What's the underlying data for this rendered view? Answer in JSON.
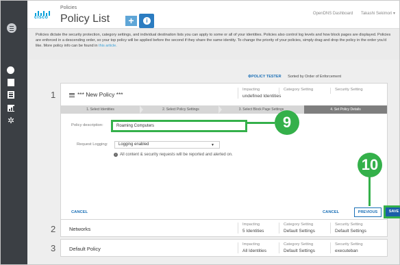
{
  "header": {
    "breadcrumb": "Policies",
    "title": "Policy List",
    "add_label": "+",
    "info_label": "i",
    "app_name": "OpenDNS Dashboard",
    "user": "Takashi Sekimori ▾",
    "logo_text": "cisco"
  },
  "banner": {
    "text": "Policies dictate the security protection, category settings, and individual destination lists you can apply to some or all of your identities.  Policies also control log levels and how block pages are displayed. Policies are enforced in a descending order, so your top policy will be applied before the second if they share the same identity. To change the priority of your policies, simply drag and drop the policy in the order you'd like.  More policy info can be found in",
    "link": "this article."
  },
  "toolbar": {
    "tester": "POLICY TESTER",
    "sort": "Sorted by Order of Enforcement"
  },
  "editing_policy": {
    "number": "1",
    "name": "*** New Policy ***",
    "impacting_label": "Impacting",
    "impacting_value": "undefined Identities",
    "category_label": "Category Setting",
    "category_value": "",
    "security_label": "Security Setting",
    "security_value": "",
    "steps": [
      "1. Select Identities",
      "2. Select Policy Settings",
      "3. Select Block Page Settings",
      "4. Set Policy Details"
    ],
    "description_label": "Policy description:",
    "description_value": "Roaming Computers",
    "logging_label": "Request Logging:",
    "logging_value": "Logging enabled",
    "logging_caret": "▼",
    "note": "All content & security requests will be reported and alerted on.",
    "note_icon": "i",
    "cancel_left": "CANCEL",
    "cancel_right": "CANCEL",
    "previous": "PREVIOUS",
    "save": "SAVE"
  },
  "callouts": {
    "c9": "9",
    "c10": "10"
  },
  "policies": [
    {
      "number": "2",
      "name": "Networks",
      "impacting_label": "Impacting",
      "impacting": "5 Identities",
      "category_label": "Category Setting",
      "category": "Default Settings",
      "security_label": "Security Setting",
      "security": "Default Settings"
    },
    {
      "number": "3",
      "name": "Default Policy",
      "impacting_label": "Impacting",
      "impacting": "All Identities",
      "category_label": "Category Setting",
      "category": "Default Settings",
      "security_label": "Security Setting",
      "security": "executeban"
    }
  ],
  "colors": {
    "accent": "#34b04a",
    "brand": "#049fd9",
    "link": "#1a6fb6",
    "rail": "#3b3f44"
  }
}
